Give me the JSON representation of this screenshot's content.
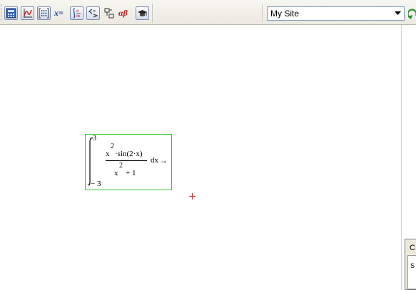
{
  "toolbar": {
    "buttons": [
      {
        "name": "calculator-toolbar-button",
        "icon": "calculator-icon"
      },
      {
        "name": "graph-toolbar-button",
        "icon": "graph-icon"
      },
      {
        "name": "matrix-toolbar-button",
        "icon": "matrix-icon"
      },
      {
        "name": "evaluation-toolbar-button",
        "icon": "x-equals-icon",
        "label": "x="
      },
      {
        "name": "calculus-toolbar-button",
        "icon": "calculus-icon"
      },
      {
        "name": "boolean-toolbar-button",
        "icon": "boolean-icon"
      },
      {
        "name": "programming-toolbar-button",
        "icon": "programming-icon"
      },
      {
        "name": "greek-toolbar-button",
        "icon": "greek-icon",
        "label": "αβ"
      },
      {
        "name": "symbolic-toolbar-button",
        "icon": "mortarboard-icon"
      }
    ],
    "x_equals_label": "x=",
    "greek_label": "αβ"
  },
  "site_selector": {
    "value": "My Site"
  },
  "side_panel": {
    "label_top": "C",
    "label_inner": "S"
  },
  "worksheet": {
    "expression": {
      "upper_limit": "3",
      "lower_limit": "− 3",
      "num_base": "x",
      "num_exp": "2",
      "num_rest": "·sin(2·x)",
      "den_base": "x",
      "den_exp": "2",
      "den_rest": "+ 1",
      "differential": "dx",
      "arrow": "→"
    }
  },
  "colors": {
    "region_border": "#33cc33",
    "cursor": "#d03030"
  }
}
